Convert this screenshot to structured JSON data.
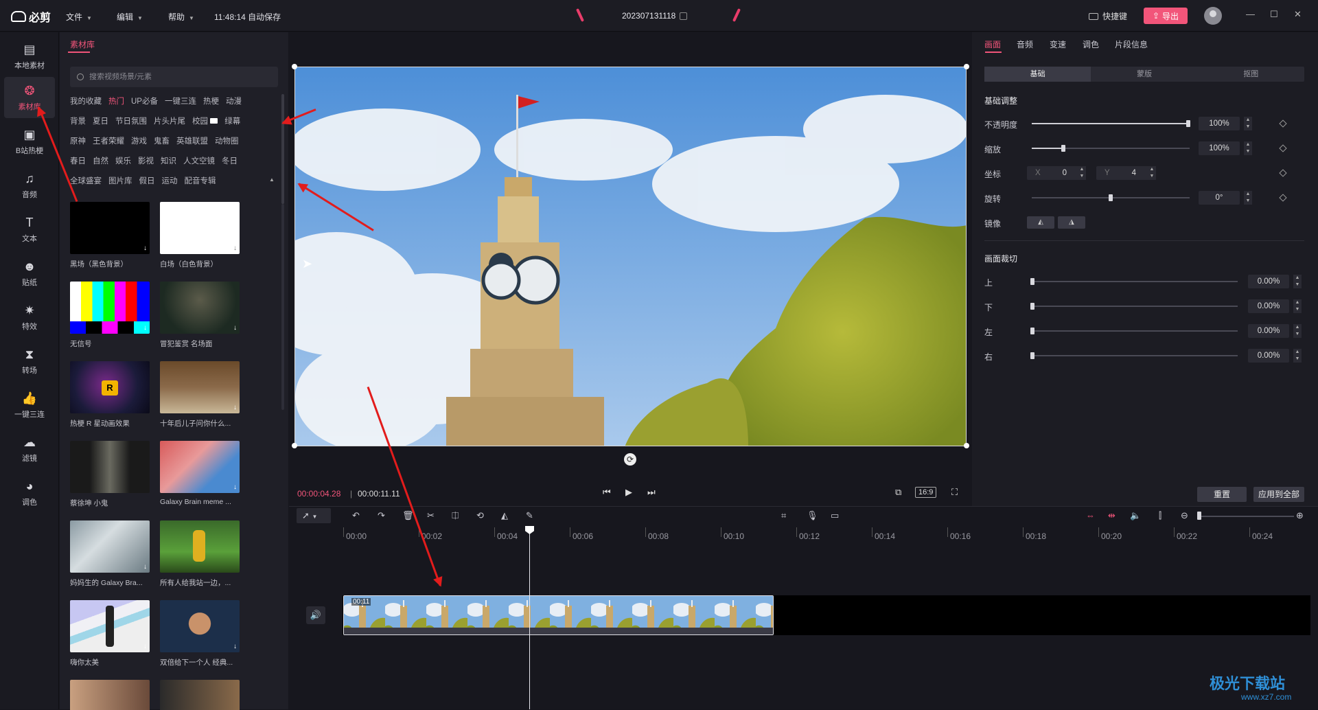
{
  "app": {
    "logo": "必剪",
    "autosave": "11:48:14 自动保存",
    "project": "202307131118",
    "shortcut": "快捷键",
    "export": "导出"
  },
  "menu": [
    "文件",
    "编辑",
    "帮助"
  ],
  "leftnav": [
    {
      "label": "本地素材",
      "icon": "folder-icon"
    },
    {
      "label": "素材库",
      "icon": "library-icon",
      "active": true
    },
    {
      "label": "B站热梗",
      "icon": "bilibili-icon"
    },
    {
      "label": "音频",
      "icon": "music-icon"
    },
    {
      "label": "文本",
      "icon": "text-icon"
    },
    {
      "label": "贴纸",
      "icon": "sticker-icon"
    },
    {
      "label": "特效",
      "icon": "effect-icon"
    },
    {
      "label": "转场",
      "icon": "transition-icon"
    },
    {
      "label": "一键三连",
      "icon": "like-icon"
    },
    {
      "label": "滤镜",
      "icon": "filter-icon"
    },
    {
      "label": "调色",
      "icon": "palette-icon"
    }
  ],
  "library": {
    "tab": "素材库",
    "search_placeholder": "搜索视频场景/元素",
    "tag_rows": [
      [
        "我的收藏",
        "热门",
        "UP必备",
        "一键三连",
        "热梗",
        "动漫"
      ],
      [
        "背景",
        "夏日",
        "节日氛围",
        "片头片尾",
        "校园",
        "绿幕"
      ],
      [
        "原神",
        "王者荣耀",
        "游戏",
        "鬼畜",
        "英雄联盟",
        "动物圈"
      ],
      [
        "春日",
        "自然",
        "娱乐",
        "影视",
        "知识",
        "人文空镜",
        "冬日"
      ],
      [
        "全球盛宴",
        "图片库",
        "假日",
        "运动",
        "配音专辑"
      ]
    ],
    "items": [
      "黑场（黑色背景）",
      "白场（白色背景）",
      "无信号",
      "冒犯鉴赏 名场面",
      "热梗 R 星动画效果",
      "十年后儿子问你什么...",
      "蔡徐坤 小鬼",
      "Galaxy Brain meme ...",
      "妈妈生的 Galaxy Bra...",
      "所有人给我站一边，...",
      "嗨你太美",
      "双倍给下一个人 经典..."
    ]
  },
  "preview": {
    "current": "00:00:04.28",
    "sep": "|",
    "total": "00:00:11.11",
    "ratio": "16:9"
  },
  "props": {
    "tabs": [
      "画面",
      "音频",
      "变速",
      "调色",
      "片段信息"
    ],
    "subtabs": [
      "基础",
      "蒙版",
      "抠图"
    ],
    "basic_title": "基础调整",
    "opacity_label": "不透明度",
    "opacity": "100%",
    "scale_label": "缩放",
    "scale": "100%",
    "pos_label": "坐标",
    "x_label": "X",
    "x": "0",
    "y_label": "Y",
    "y": "4",
    "rotate_label": "旋转",
    "rotate": "0°",
    "mirror_label": "镜像",
    "crop_title": "画面裁切",
    "crop": [
      {
        "label": "上",
        "value": "0.00%"
      },
      {
        "label": "下",
        "value": "0.00%"
      },
      {
        "label": "左",
        "value": "0.00%"
      },
      {
        "label": "右",
        "value": "0.00%"
      }
    ],
    "reset": "重置",
    "apply_all": "应用到全部"
  },
  "timeline": {
    "ticks": [
      "00:00",
      "00:02",
      "00:04",
      "00:06",
      "00:08",
      "00:10",
      "00:12",
      "00:14",
      "00:16",
      "00:18",
      "00:20",
      "00:22",
      "00:24"
    ],
    "clip_label": "00:11"
  },
  "watermark": {
    "title": "极光下载站",
    "url": "www.xz7.com"
  },
  "colors": {
    "accent": "#f2557a",
    "arrow": "#e21c1c"
  }
}
